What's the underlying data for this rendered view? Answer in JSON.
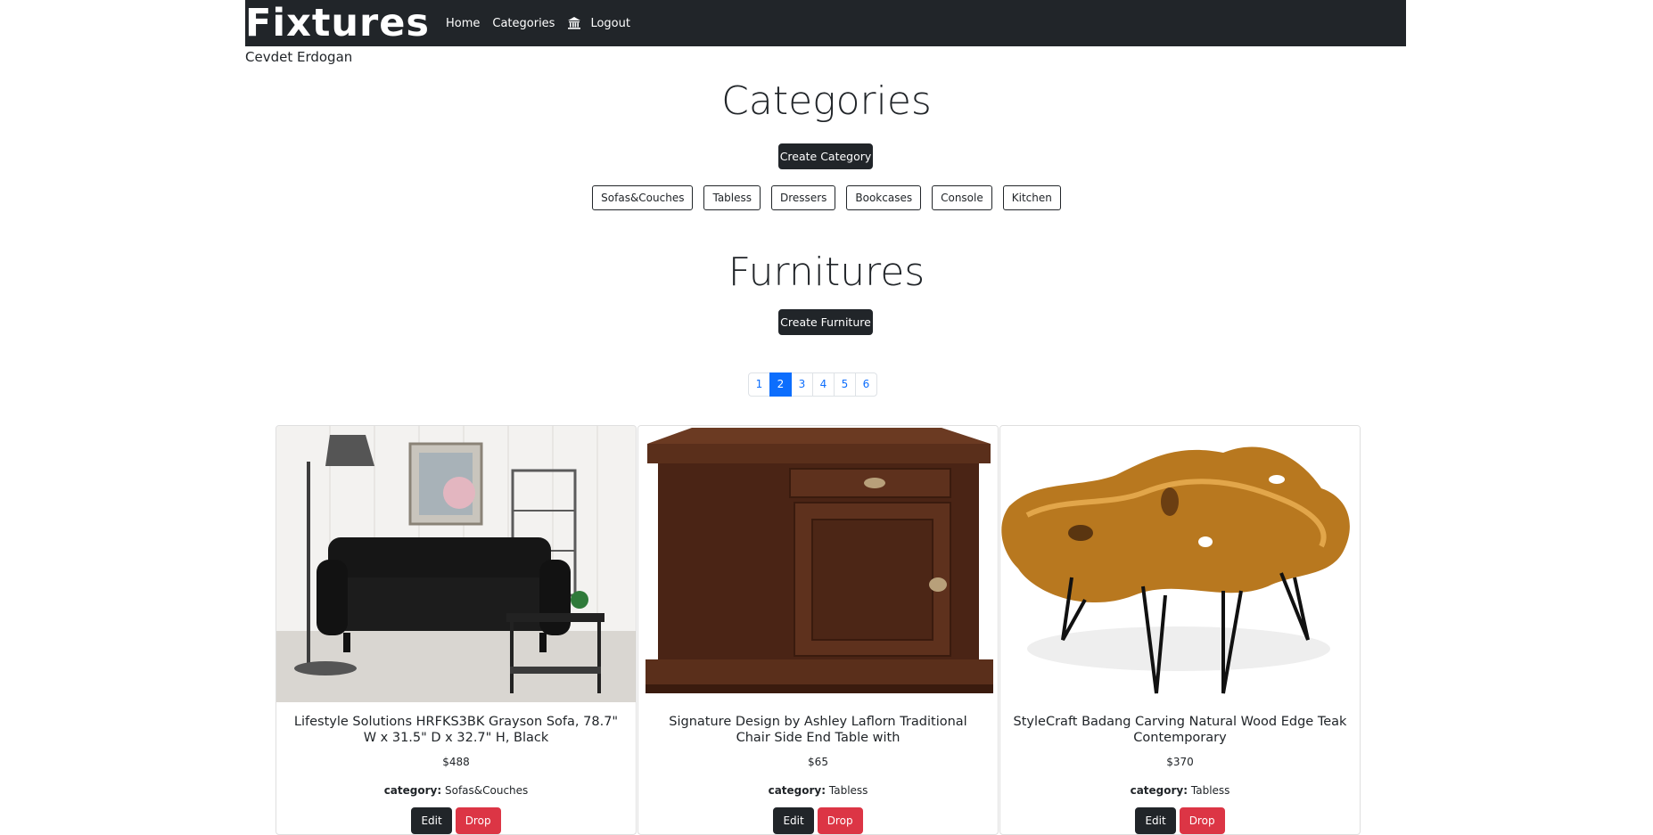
{
  "navbar": {
    "brand": "Fixtures",
    "links": {
      "home": "Home",
      "categories": "Categories",
      "logout": "Logout"
    },
    "logout_icon": "bank-icon"
  },
  "user": {
    "name": "Cevdet Erdogan"
  },
  "categories_section": {
    "title": "Categories",
    "create_label": "Create Category",
    "items": [
      "Sofas&Couches",
      "Tabless",
      "Dressers",
      "Bookcases",
      "Console",
      "Kitchen"
    ]
  },
  "furnitures_section": {
    "title": "Furnitures",
    "create_label": "Create Furniture"
  },
  "pagination": {
    "pages": [
      "1",
      "2",
      "3",
      "4",
      "5",
      "6"
    ],
    "active": "2"
  },
  "cards": [
    {
      "title": "Lifestyle Solutions HRFKS3BK Grayson Sofa, 78.7\" W x 31.5\" D x 32.7\" H, Black",
      "price": "$488",
      "category_label": "category:",
      "category": "Sofas&Couches",
      "edit_label": "Edit",
      "drop_label": "Drop"
    },
    {
      "title": "Signature Design by Ashley Laflorn Traditional Chair Side End Table with",
      "price": "$65",
      "category_label": "category:",
      "category": "Tabless",
      "edit_label": "Edit",
      "drop_label": "Drop"
    },
    {
      "title": "StyleCraft Badang Carving Natural Wood Edge Teak Contemporary",
      "price": "$370",
      "category_label": "category:",
      "category": "Tabless",
      "edit_label": "Edit",
      "drop_label": "Drop"
    }
  ],
  "colors": {
    "dark": "#212529",
    "primary": "#0d6efd",
    "danger": "#dc3545"
  }
}
